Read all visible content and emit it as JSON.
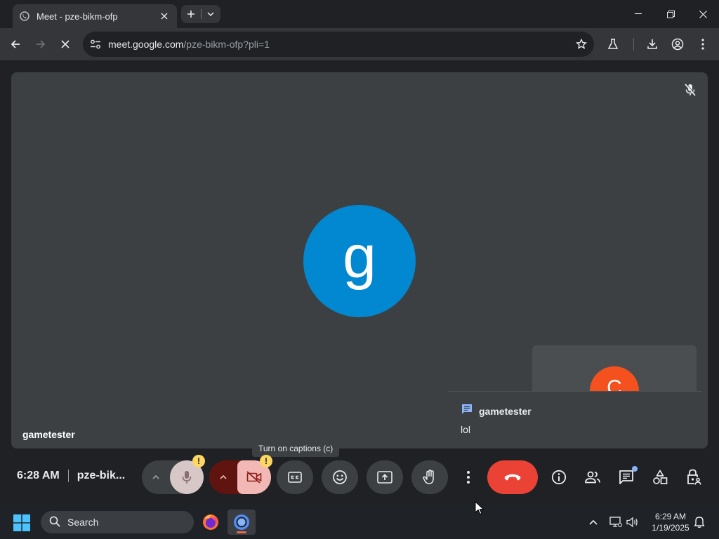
{
  "browser": {
    "tab_title": "Meet - pze-bikm-ofp",
    "url_host": "meet.google.com",
    "url_path": "/pze-bikm-ofp?pli=1"
  },
  "meet": {
    "main_participant_initial": "g",
    "main_participant_name": "gametester",
    "self_initial": "C",
    "chat_sender": "gametester",
    "chat_message": "lol",
    "tooltip": "Turn on captions (c)",
    "time": "6:28 AM",
    "meeting_code": "pze-bik...",
    "warning_badge": "!"
  },
  "taskbar": {
    "search_placeholder": "Search",
    "clock_time": "6:29 AM",
    "clock_date": "1/19/2025"
  },
  "colors": {
    "accent_blue": "#0288d1",
    "self_avatar": "#f4511e",
    "end_call": "#ea4335",
    "warning": "#fdd663"
  }
}
